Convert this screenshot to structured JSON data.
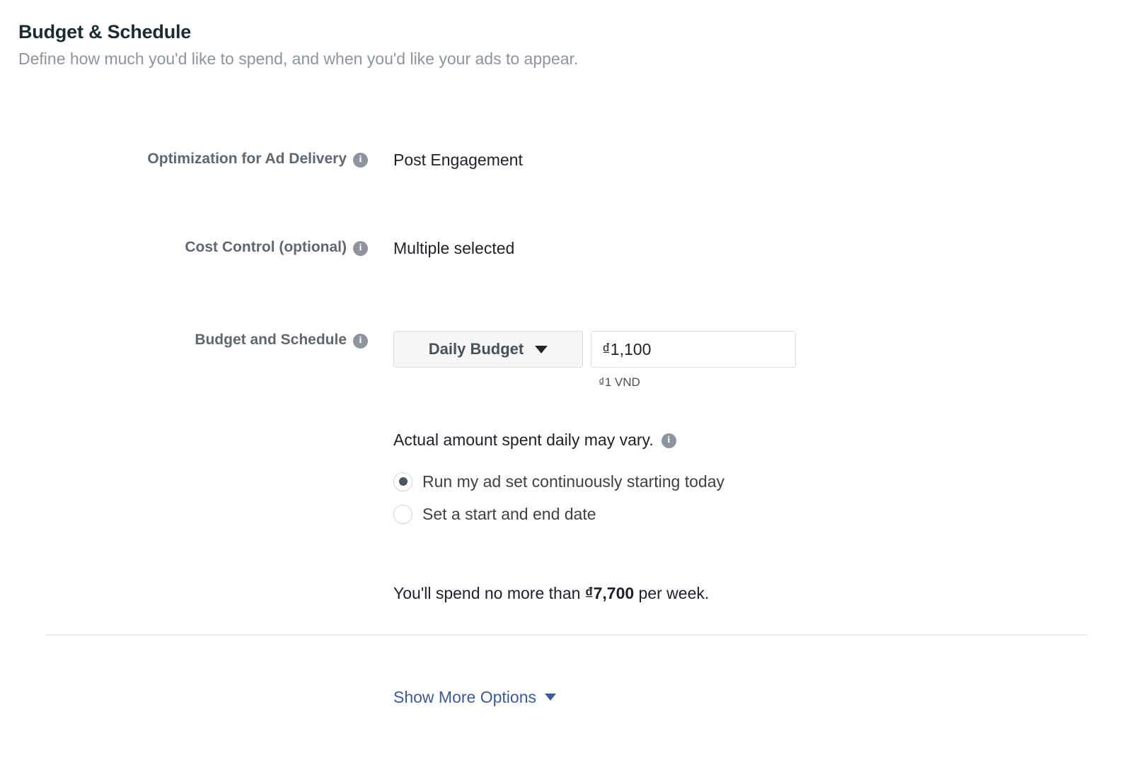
{
  "header": {
    "title": "Budget & Schedule",
    "subtitle": "Define how much you'd like to spend, and when you'd like your ads to appear."
  },
  "icons": {
    "info": "i",
    "info_name": "info-icon",
    "caret": "chevron-down-icon"
  },
  "rows": {
    "optimization": {
      "label": "Optimization for Ad Delivery",
      "value": "Post Engagement"
    },
    "cost_control": {
      "label": "Cost Control (optional)",
      "value": "Multiple selected"
    },
    "budget_schedule": {
      "label": "Budget and Schedule",
      "budget_type": "Daily Budget",
      "budget_amount": "₫1,100",
      "currency_hint": "₫1 VND"
    }
  },
  "schedule": {
    "vary_note": "Actual amount spent daily may vary.",
    "options": [
      {
        "label": "Run my ad set continuously starting today",
        "selected": true
      },
      {
        "label": "Set a start and end date",
        "selected": false
      }
    ]
  },
  "spend_summary": {
    "prefix": "You'll spend no more than ",
    "amount": "₫7,700",
    "suffix": " per week."
  },
  "footer": {
    "show_more_label": "Show More Options"
  },
  "colors": {
    "link": "#3c5a9a",
    "title": "#1c2b33",
    "subtitle": "#8d949e",
    "label": "#606770",
    "value": "#1d2129",
    "info_icon_bg": "#8d949e",
    "select_bg": "#f5f6f7",
    "border": "#dddfe2",
    "divider": "#ebedf0"
  }
}
